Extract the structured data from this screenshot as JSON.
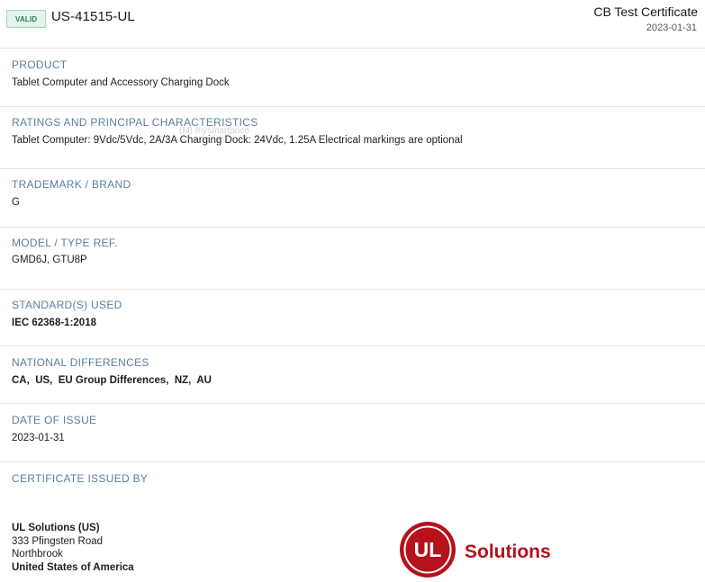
{
  "header": {
    "badge": "VALID",
    "certificate_id": "US-41515-UL",
    "certificate_type": "CB Test Certificate",
    "date": "2023-01-31"
  },
  "watermark": "(M) mysmartprice",
  "sections": {
    "product": {
      "label": "PRODUCT",
      "value": "Tablet Computer and Accessory Charging Dock"
    },
    "ratings": {
      "label": "RATINGS AND PRINCIPAL CHARACTERISTICS",
      "value": "Tablet Computer: 9Vdc/5Vdc, 2A/3A Charging Dock: 24Vdc, 1.25A Electrical markings are optional"
    },
    "trademark": {
      "label": "TRADEMARK / BRAND",
      "value": "G"
    },
    "model": {
      "label": "MODEL / TYPE REF.",
      "value": "GMD6J, GTU8P"
    },
    "standards": {
      "label": "STANDARD(S) USED",
      "value": "IEC 62368-1:2018"
    },
    "national": {
      "label": "NATIONAL DIFFERENCES",
      "value": "CA,  US,  EU Group Differences,  NZ,  AU"
    },
    "issue_date": {
      "label": "DATE OF ISSUE",
      "value": "2023-01-31"
    },
    "issuer": {
      "label": "CERTIFICATE ISSUED BY",
      "name": "UL Solutions (US)",
      "street": "333 Pfingsten Road",
      "city": "Northbrook",
      "country": "United States of America"
    }
  },
  "logo": {
    "mark": "UL",
    "text": "Solutions",
    "color": "#b5121b"
  },
  "colors": {
    "label": "#5a7fa0",
    "badge_bg": "#e3f5ea",
    "badge_text": "#2b7a4b",
    "divider": "#e6e6e6"
  }
}
